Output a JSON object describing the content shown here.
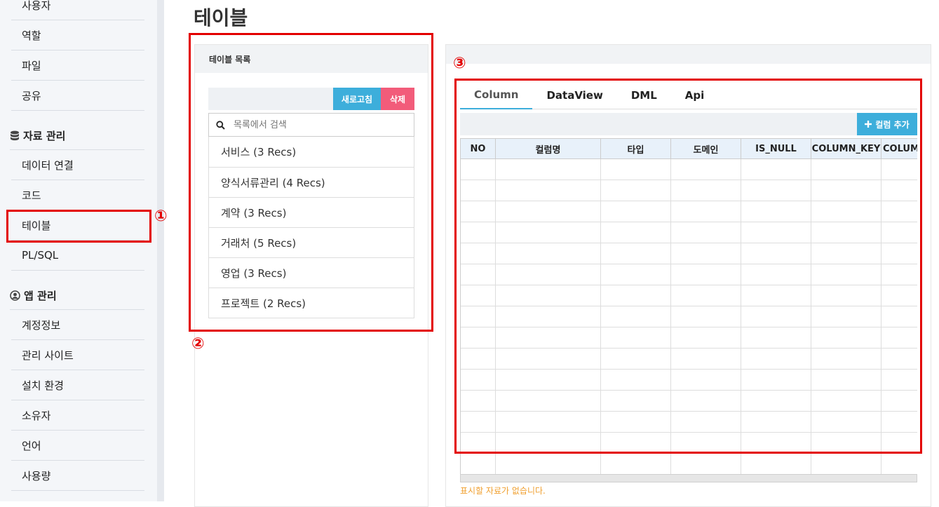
{
  "sidebar": {
    "items_top": [
      "사용자",
      "역할",
      "파일",
      "공유"
    ],
    "section_data": "자료 관리",
    "items_data": [
      "데이터 연결",
      "코드",
      "테이블",
      "PL/SQL"
    ],
    "section_app": "앱 관리",
    "items_app": [
      "계정정보",
      "관리 사이트",
      "설치 환경",
      "소유자",
      "언어",
      "사용량"
    ]
  },
  "annotations": {
    "one": "①",
    "two": "②",
    "three": "③"
  },
  "page": {
    "title": "테이블"
  },
  "table_list": {
    "header": "테이블 목록",
    "refresh_label": "새로고침",
    "delete_label": "삭제",
    "search_placeholder": "목록에서 검색",
    "items": [
      "서비스 (3 Recs)",
      "양식서류관리 (4 Recs)",
      "계약 (3 Recs)",
      "거래처 (5 Recs)",
      "영업 (3 Recs)",
      "프로젝트 (2 Recs)"
    ]
  },
  "detail": {
    "tabs": [
      "Column",
      "DataView",
      "DML",
      "Api"
    ],
    "active_tab": "Column",
    "add_column_label": "컬럼 추가",
    "columns": [
      "NO",
      "컬럼명",
      "타입",
      "도메인",
      "IS_NULL",
      "COLUMN_KEY",
      "COLUMN_DEFAULT"
    ],
    "empty_message": "표시할 자료가 없습니다."
  },
  "colors": {
    "accent": "#3daedb",
    "danger": "#f25c7a",
    "annotation": "#e30000",
    "warning_text": "#f0a030"
  }
}
